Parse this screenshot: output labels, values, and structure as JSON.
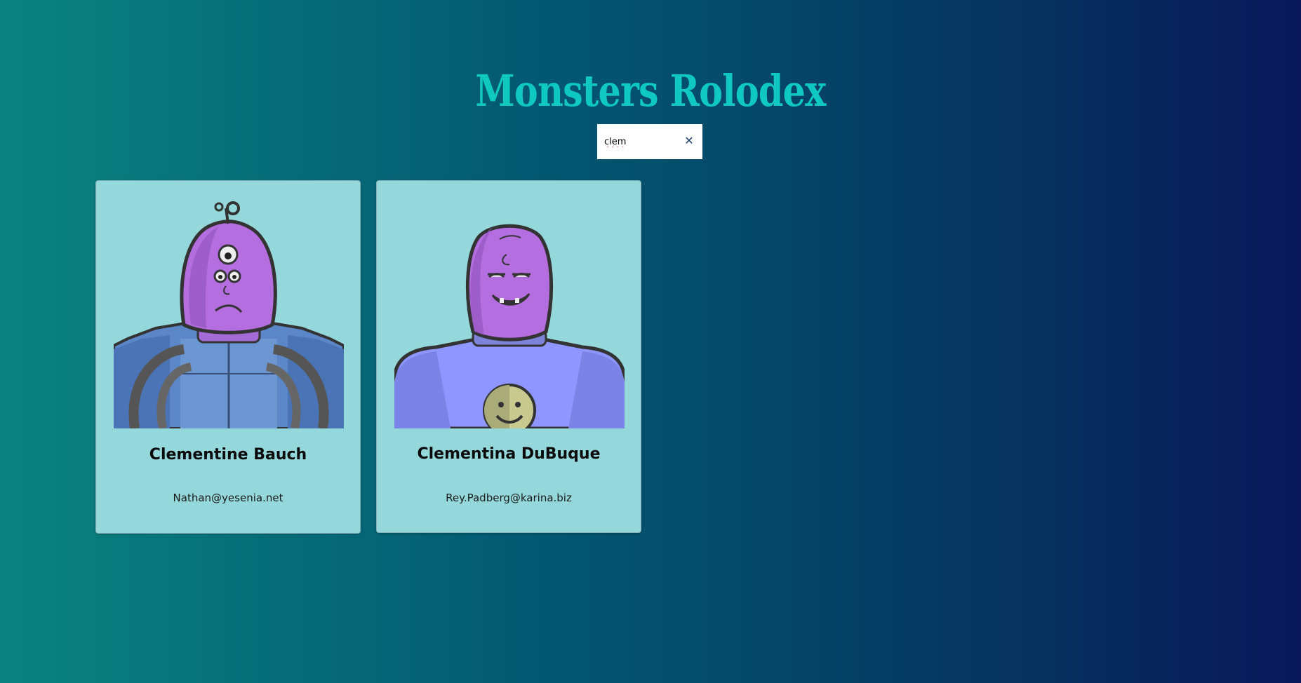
{
  "app": {
    "title": "Monsters Rolodex"
  },
  "search": {
    "value": "clem",
    "clear_icon": "close-icon"
  },
  "monsters": [
    {
      "name": "Clementine Bauch",
      "email": "Nathan@yesenia.net",
      "avatar_icon": "monster-avatar-robot"
    },
    {
      "name": "Clementina DuBuque",
      "email": "Rey.Padberg@karina.biz",
      "avatar_icon": "monster-avatar-smiley"
    }
  ],
  "colors": {
    "title": "#0fc9c0",
    "card_background": "#95d8db",
    "background_start": "#0a8380",
    "background_end": "#09175a"
  }
}
